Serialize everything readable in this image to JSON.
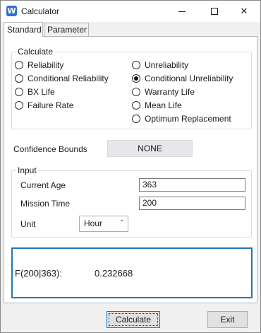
{
  "window": {
    "title": "Calculator",
    "app_icon_letter": "W",
    "icons": [
      "app-icon",
      "minimize-icon",
      "maximize-icon",
      "close-icon"
    ]
  },
  "tabs": [
    {
      "label": "Standard",
      "active": true
    },
    {
      "label": "Parameter",
      "active": false
    }
  ],
  "calculate": {
    "group_label": "Calculate",
    "options_left": [
      "Reliability",
      "Conditional Reliability",
      "BX Life",
      "Failure Rate"
    ],
    "options_right": [
      "Unreliability",
      "Conditional Unreliability",
      "Warranty Life",
      "Mean Life",
      "Optimum Replacement"
    ],
    "selected": "Conditional Unreliability"
  },
  "confidence_bounds": {
    "label": "Confidence Bounds",
    "value": "NONE"
  },
  "input": {
    "group_label": "Input",
    "current_age_label": "Current Age",
    "current_age": "363",
    "mission_time_label": "Mission Time",
    "mission_time": "200",
    "unit_label": "Unit",
    "unit": "Hour"
  },
  "result": {
    "label": "F(200|363):",
    "value": "0.232668"
  },
  "buttons": {
    "calculate": "Calculate",
    "exit": "Exit"
  },
  "colors": {
    "result_border": "#1f78b4",
    "app_icon": "#2f6fcf"
  }
}
